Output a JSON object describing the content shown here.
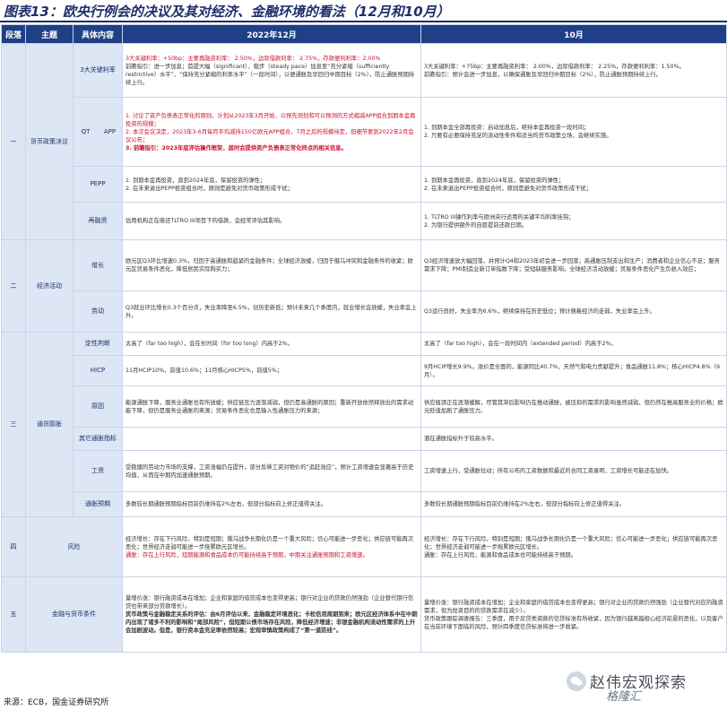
{
  "title": "图表13：欧央行例会的决议及其对经济、金融环境的看法（12月和10月）",
  "headers": [
    "段落",
    "主题",
    "具体内容",
    "2022年12月",
    "10月"
  ],
  "sections": {
    "s1": {
      "num": "一",
      "topic": "货币政策决议"
    },
    "s2": {
      "num": "二",
      "topic": "经济活动"
    },
    "s3": {
      "num": "三",
      "topic": "通货膨胀"
    },
    "s4": {
      "num": "四",
      "topic": "风险"
    },
    "s5": {
      "num": "五",
      "topic": "金融与货币条件"
    }
  },
  "labels": {
    "rate": "3大关键利率",
    "qt": "QT",
    "app": "APP",
    "pepp": "PEPP",
    "refi": "再融资",
    "growth": "增长",
    "labor": "劳动",
    "qual": "定性判断",
    "hicp": "HICP",
    "cause": "原因",
    "other": "其它通胀指标",
    "wage": "工资",
    "expect": "通胀预期"
  },
  "dec": {
    "rate": "3大关键利率：+50bp：主要再融资利率： 2.50%，边际借款利率： 2.75%，存款便利利率：2.00%",
    "rate2": "前瞻指引：进一步加息；首提大幅（significant）、稳步（steady pace）加息至“充分紧缩（sufficiently restrictive）水平”、“保持充分紧缩的利率水平”（一段时间），以便通胀及早回归中期目标（2%），防止通胀预期持续上行。",
    "app": "1. 讨论了资产负债表正常化的原则，计划从2023年3月开始，以预先测划和可以预测的方式缩减APP组合到期本金再投资的规模；",
    "app2": "2. 本次会议决定，2023年3-6月每月平均减持150亿欧元APP组合，7月之后的规模待定，但细节要到2022年2月会议公布；",
    "app3": "3. 前瞻指引：2023年底评估操作框架，届时会提供资产负债表正常化终点的相关信息。",
    "pepp": "1. 到期本金再投资，直到2024年底，保留投资的弹性；",
    "pepp2": "2. 在未来退出PEPP投资组合时，原则是避免对货币政策形成干扰；",
    "refi": "估用机构正在偿还TLTRO III项目下的借款，会经常评估其影响。",
    "growth": "欧元区Q3环比增速0.3%，归因于高通胀和趋紧的金融条件；全球经济放缓，归因于俄乌冲突和金融条件的收紧；欧元区贸易条件恶化，降低居民实际购买力；",
    "labor": "Q3就业环比增长0.3个百分点，失业率降至6.5%，创历史新低；预计未来几个季度内，就业增长会放缓，失业率会上升。",
    "qual": "太高了（far too high），会在长时间（for too long）内高于2%。",
    "hicp": "11月HCIP10%，前值10.6%；11月核心HICP5%，前值5%；",
    "cause": "能源通胀下降，服务业通胀也有所放缓；供应链压力逐渐减弱，但仍是高通胀的原因；重新开放依然释放出的需求动能下降，但仍是服务业通胀的来源；贸易条件恶化也是输入性通胀压力的来源；",
    "other": "",
    "wage": "受稳健的劳动力市场的支撑，工资涨幅仍在提升，部分反映工资对物价的“追赶效应”，预计工资增速会显著高于历史均值，从而在中期内加速通胀预期。",
    "expect": "多数较长期通胀预期指标目前仍维持在2%左右，但部分指标向上修正值得关注。",
    "risk": "经济增长：存在下行风险，特别是短期；俄乌战争长期化仍是一个重大风险；信心可能进一步恶化；供应链可能再次恶化；世界经济走弱可能进一步拖累欧元区增长。",
    "risk2": "通胀：存在上行风险，短期能源和食品成本仍可能持续高于预期，中期关注通胀预期和工资增速。",
    "fin": "量增价涨：银行融资成本在增加；企业和家庭的借贷成本也变得更高；银行对企业的贷款仍然强劲（企业替代银行信贷也带来部分贷款增长）。",
    "fin2": "货币政策与金融稳定关系的评估：由6月评估以来，金融稳定环境恶化；卡松信用周期到来；欧元区经济体系中在中期内出现了诸多不利的影响和“尾部风险”，但短期公债市场存在风险，降低经济增速；非银金融机构流动性需求的上升会加剧波动。但是，银行资本金充足率依然较高；宏观审慎政策构成了“第一道防线”。"
  },
  "oct": {
    "rate": "3大关键利率：+75bp：主要再融资利率： 2.00%，边际借款利率： 2.25%，存款便利利率：1.50%。",
    "rate2": "前瞻指引：预计会进一步加息，以确保通胀及早回归中期目标（2%），防止通胀预期持续上行。",
    "app": "1. 到期本金全部再投资：启动加息后，继持本金再投资一段时间；",
    "app2": "2. 只要有必要保持充足的流动性条件和适当的货币政策立场，会继续实施。",
    "pepp": "1. 到期本金再投资，直到2024年底，保留投资的弹性；",
    "pepp2": "2. 在未来退出PEPP投资组合时，原则是避免对货币政策形成干扰；",
    "refi": "1. TLTRO III操作利率与欧洲央行适用的关键平均利率挂钩；",
    "refi2": "2. 为银行提供额外的自愿提前还款日期。",
    "growth": "Q3经济增速放大幅回落，并预计Q4和2023年初会进一步回落；高通胀压制支出和生产；消费者和企业信心不足；服务需求下降；PMI制造业新订单指数下降；受短缺服务影响，全球经济活动放缓；贸易条件恶化产生负收入效应；",
    "labor": "Q3运行良好，失业率为6.6%，继续保持在历史低位；预计随着经济的走弱，失业率会上升。",
    "qual": "太高了（far too high），会在一段时间内（extended period）内高于2%。",
    "hicp": "9月HCIP增长9.9%，涨价是全面的，能源同比40.7%，天然气和电力贡献提升；食品通胀11.8%；核心HICP4.8%（9月）。",
    "cause": "供应瓶颈正在逐渐缓解，尽管其滞后影响仍在推动通胀，被压抑的需求的影响虽然减弱，但仍然在推高服务业的价格；欧元贬值加剧了通胀压力。",
    "other": "潜在通胀指标升于较高水平。",
    "wage": "工资增速上行，受通胀拉动；所有公布的工资数据和最近的合同工资录明，工资增长可能还在加快。",
    "expect": "多数较长期通胀预期指标目前仍维持在2%左右，但部分指标向上修正值得关注。",
    "risk": "经济增长：存在下行风险，特别是短期；俄乌战争长期化仍是一个重大风险；信心可能进一步恶化；供应链可能再次恶化；世界经济走弱可能进一步拖累欧元区增长。",
    "risk2": "通胀：存在上行风险，能源和食品成本也可能持续高于预期。",
    "fin": "量增价涨：银行融资成本在增加；企业和家庭的借贷成本也变得更高；银行对企业的贷款仍然强劲（企业替代对应的融资需求，但为投资目的的贷款需求在减少）。",
    "fin2": "货币政策跟踪调查报告：三季度，用于房贷类资款的信贷标准有所收紧，因为银行越来越担心经济前景的恶化，以及客户在当前环境下面临的风险，预计四季度信贷标准将进一步收紧。"
  },
  "source": "来源：ECB，国金证券研究所",
  "watermark": "赵伟宏观探索",
  "watermark_brand": "格隆汇"
}
